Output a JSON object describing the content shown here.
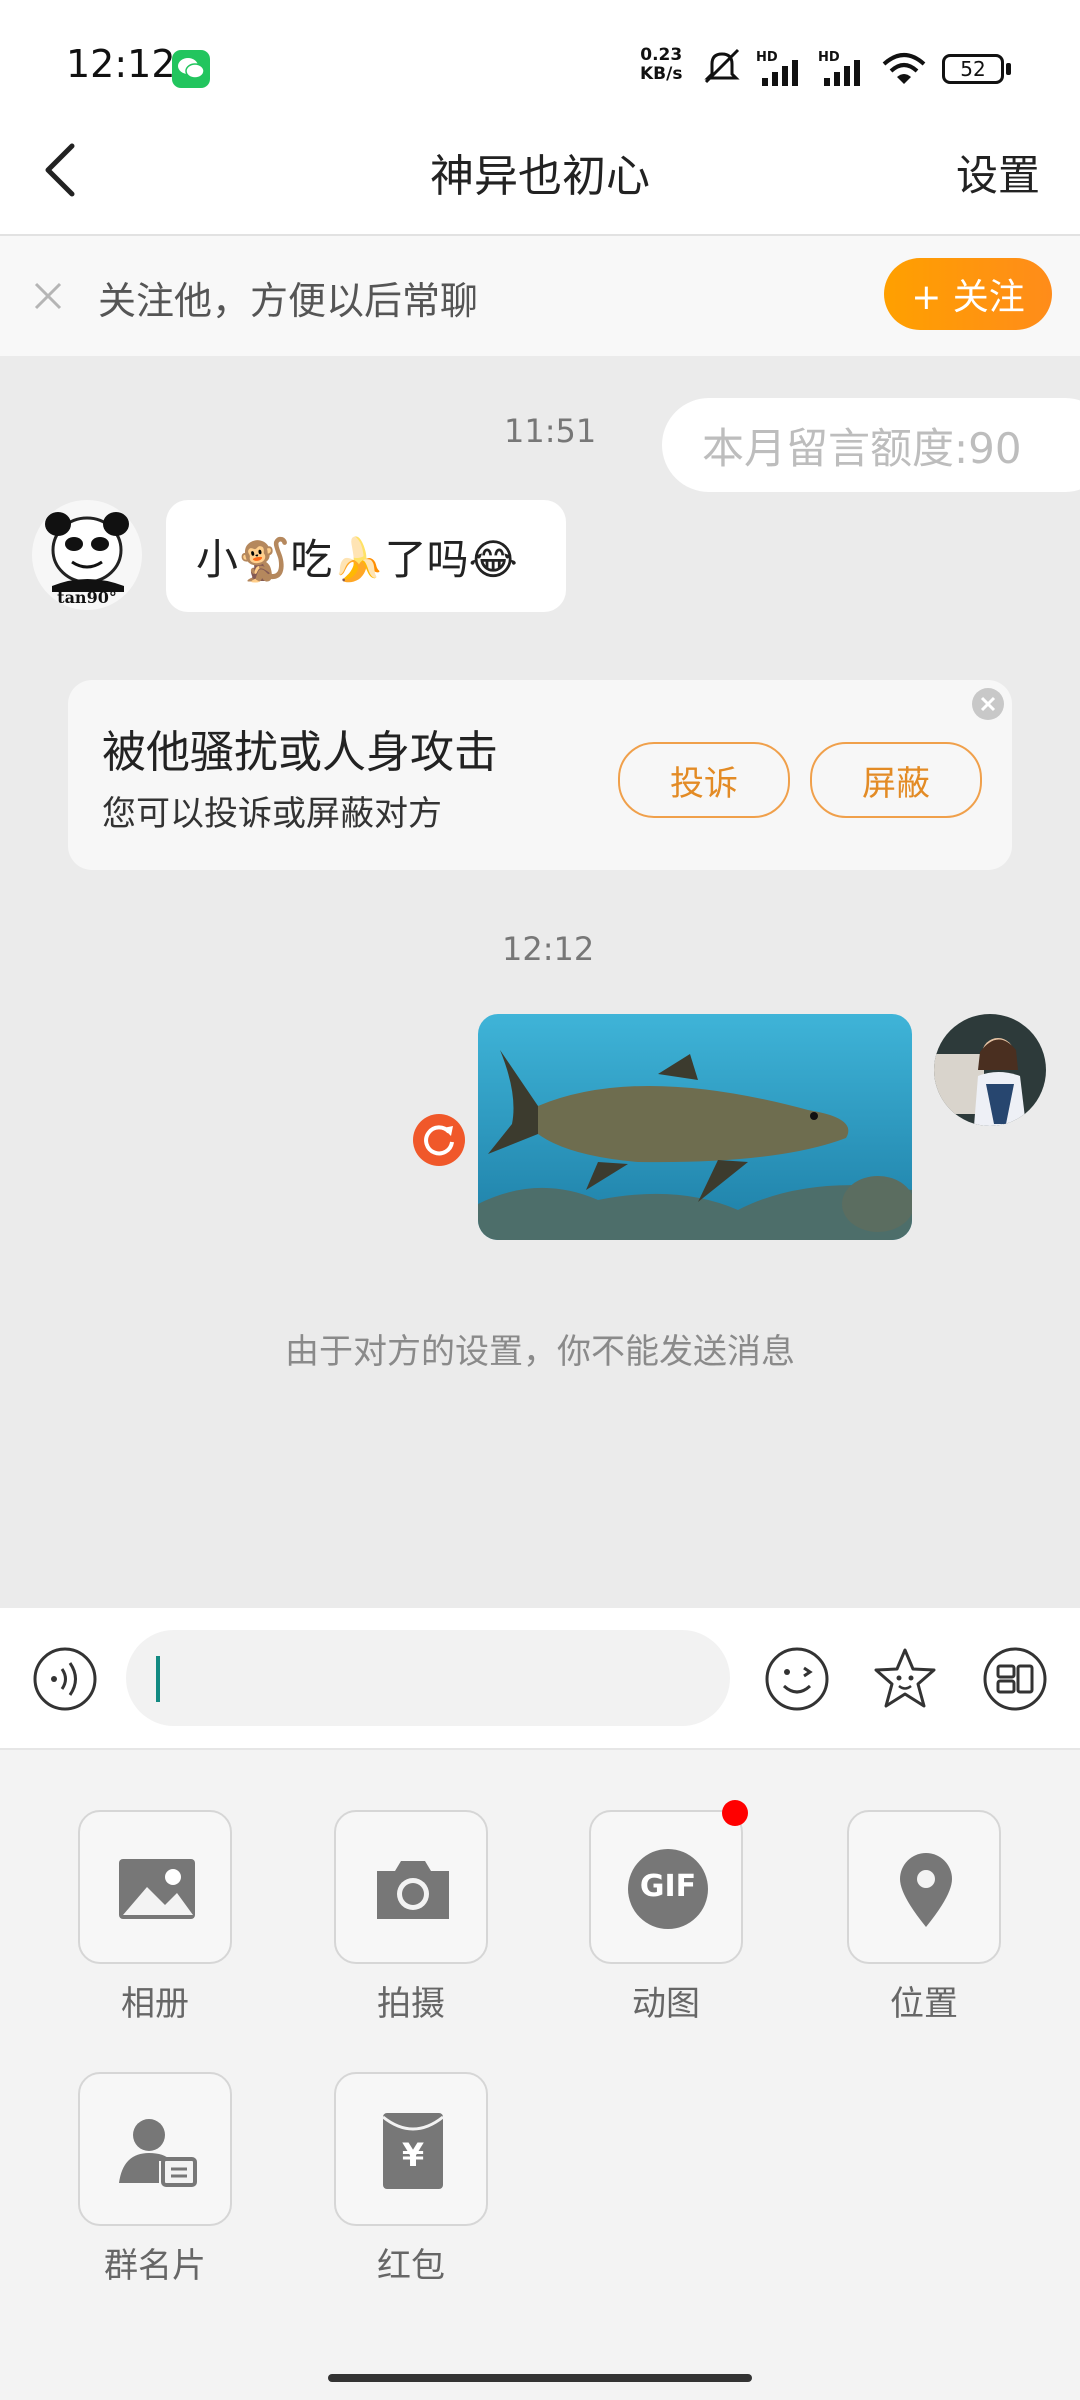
{
  "status_bar": {
    "time": "12:12",
    "net_speed_value": "0.23",
    "net_speed_unit": "KB/s",
    "signal1_label": "HD",
    "signal2_label": "HD",
    "battery": "52"
  },
  "header": {
    "title": "神异也初心",
    "settings_label": "设置"
  },
  "follow_bar": {
    "text": "关注他，方便以后常聊",
    "button_label": "+ 关注"
  },
  "chat": {
    "timestamp1": "11:51",
    "quota": "本月留言额度:90",
    "incoming_avatar_caption": "tan90°",
    "incoming_message": "小🐒吃🍌了吗😂",
    "report_card": {
      "title": "被他骚扰或人身攻击",
      "subtitle": "您可以投诉或屏蔽对方",
      "report_label": "投诉",
      "block_label": "屏蔽"
    },
    "timestamp2": "12:12",
    "notice": "由于对方的设置，你不能发送消息"
  },
  "input": {
    "value": ""
  },
  "panel": {
    "items": [
      {
        "label": "相册",
        "icon": "photo-icon"
      },
      {
        "label": "拍摄",
        "icon": "camera-icon"
      },
      {
        "label": "动图",
        "icon": "gif-icon",
        "badge": "GIF"
      },
      {
        "label": "位置",
        "icon": "location-icon"
      },
      {
        "label": "群名片",
        "icon": "contact-card-icon"
      },
      {
        "label": "红包",
        "icon": "red-packet-icon",
        "badge": "¥"
      }
    ]
  },
  "colors": {
    "accent_orange": "#ff9a0e",
    "retry_red": "#f0582a",
    "unread_dot": "#ff0000"
  }
}
